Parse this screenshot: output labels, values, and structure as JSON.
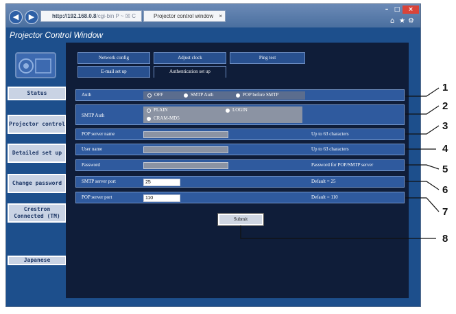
{
  "browser": {
    "address_url_host": "http://192.168.0.8",
    "address_url_tail": "/cgi-bin P ~ ☒ C",
    "tab_title": "Projector control window",
    "tab_close": "×",
    "window_controls": [
      "–",
      "□",
      "×"
    ],
    "right_icons": [
      "⌂",
      "★",
      "⚙"
    ]
  },
  "app": {
    "title": "Projector Control Window"
  },
  "sidebar": {
    "items": [
      {
        "label": "Status"
      },
      {
        "label": "Projector control"
      },
      {
        "label": "Detailed set up"
      },
      {
        "label": "Change password"
      },
      {
        "label": "Crestron Connected (TM)"
      },
      {
        "label": "Japanese"
      }
    ]
  },
  "tabs": [
    {
      "label": "Network config"
    },
    {
      "label": "Adjust clock"
    },
    {
      "label": "Ping test"
    },
    {
      "label": "E-mail set up"
    },
    {
      "label": "Authentication set up"
    }
  ],
  "form": {
    "auth": {
      "label": "Auth",
      "options": [
        "OFF",
        "SMTP Auth",
        "POP before SMTP"
      ],
      "selected": "SMTP Auth"
    },
    "smtp_auth": {
      "label": "SMTP Auth",
      "options": [
        "PLAIN",
        "LOGIN",
        "CRAM-MD5"
      ],
      "selected": "LOGIN"
    },
    "pop_server_name": {
      "label": "POP server name",
      "value": "",
      "hint": "Up to 63 characters"
    },
    "user_name": {
      "label": "User name",
      "value": "",
      "hint": "Up to 63 characters"
    },
    "password": {
      "label": "Password",
      "value": "",
      "hint": "Password for POP/SMTP server"
    },
    "smtp_server_port": {
      "label": "SMTP server port",
      "value": "25",
      "hint": "Default = 25"
    },
    "pop_server_port": {
      "label": "POP server port",
      "value": "110",
      "hint": "Default = 110"
    },
    "submit_label": "Submit"
  },
  "callouts": [
    "1",
    "2",
    "3",
    "4",
    "5",
    "6",
    "7",
    "8"
  ]
}
